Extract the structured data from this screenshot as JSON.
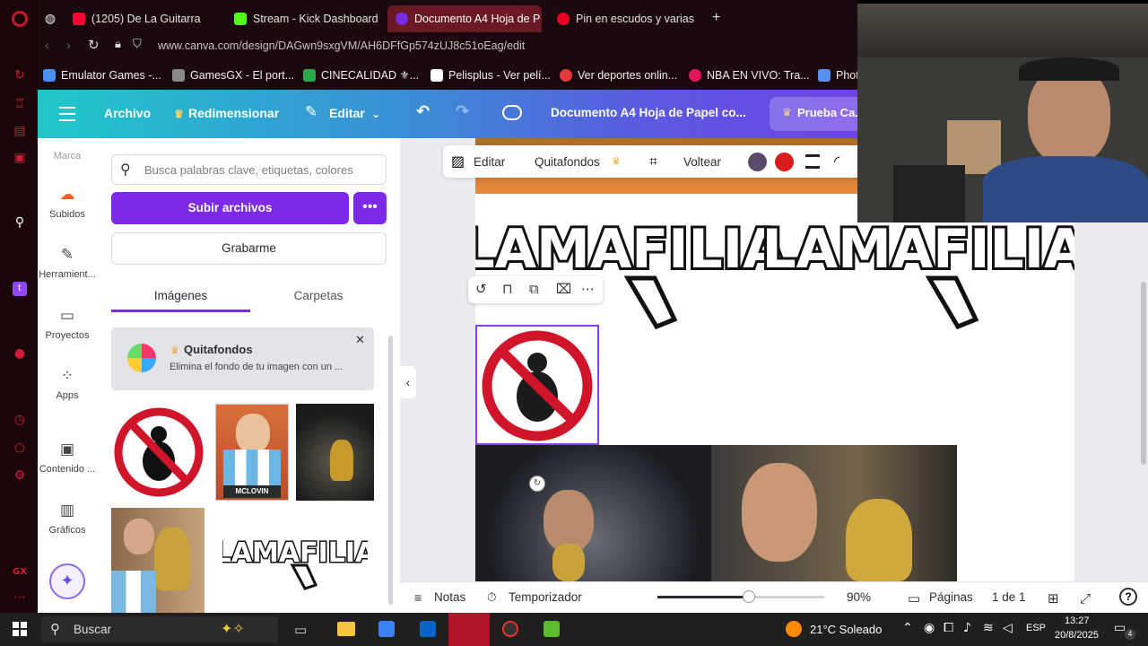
{
  "browser": {
    "tabs": [
      {
        "label": "(1205) De La Guitarra",
        "icon": "youtube-icon",
        "color": "#ff0033",
        "audio": true
      },
      {
        "label": "Stream - Kick Dashboard",
        "icon": "kick-icon",
        "color": "#53fc18"
      },
      {
        "label": "Documento A4 Hoja de P",
        "icon": "canva-icon",
        "color": "#7d2ae8",
        "active": true
      },
      {
        "label": "Pin en escudos y varias",
        "icon": "pinterest-icon",
        "color": "#e60023"
      }
    ],
    "url": "www.canva.com/design/DAGwn9sxgVM/AH6DFfGp574zUJ8c51oEag/edit",
    "bookmarks": [
      {
        "label": "Emulator Games -...",
        "color": "#4a8ef0"
      },
      {
        "label": "GamesGX - El port...",
        "color": "#888888"
      },
      {
        "label": "CINECALIDAD ⚜...",
        "color": "#2ba84a"
      },
      {
        "label": "Pelisplus - Ver pelí...",
        "color": "#ffffff"
      },
      {
        "label": "Ver deportes onlin...",
        "color": "#e23a3a"
      },
      {
        "label": "NBA EN VIVO: Tra...",
        "color": "#e2165d"
      },
      {
        "label": "Photo",
        "color": "#5b8ef0"
      }
    ]
  },
  "header": {
    "archivo": "Archivo",
    "redimensionar": "Redimensionar",
    "editar": "Editar",
    "doc_title": "Documento A4 Hoja de Papel co...",
    "prueba": "Prueba Ca..."
  },
  "rail": {
    "marca": "Marca",
    "items": [
      {
        "label": "Subidos",
        "icon": "cloud-upload-icon"
      },
      {
        "label": "Herramient...",
        "icon": "pen-tool-icon"
      },
      {
        "label": "Proyectos",
        "icon": "folder-icon"
      },
      {
        "label": "Apps",
        "icon": "apps-grid-icon"
      },
      {
        "label": "Contenido ...",
        "icon": "image-content-icon"
      },
      {
        "label": "Gráficos",
        "icon": "chart-icon"
      }
    ]
  },
  "panel": {
    "search_placeholder": "Busca palabras clave, etiquetas, colores",
    "upload": "Subir archivos",
    "record": "Grabarme",
    "tab_images": "Imágenes",
    "tab_folders": "Carpetas",
    "promo_title": "Quitafondos",
    "promo_desc": "Elimina el fondo de tu imagen con un ...",
    "mclovin_label": "MCLOVIN",
    "thumb_logo_text": "LAMAFILIA"
  },
  "toolbar": {
    "edit": "Editar",
    "quitafondos": "Quitafondos",
    "voltear": "Voltear",
    "colors": [
      "#5a4a6a",
      "#d81b1b"
    ]
  },
  "canvas": {
    "logo_text": "LAMAFILIA"
  },
  "footer": {
    "notas": "Notas",
    "timer": "Temporizador",
    "zoom": "90%",
    "zoom_level": 0.55,
    "paginas": "Páginas",
    "pages": "1 de 1"
  },
  "taskbar": {
    "search": "Buscar",
    "weather": "21°C Soleado",
    "lang": "ESP",
    "time": "13:27",
    "date": "20/8/2025",
    "notif_count": "4"
  }
}
